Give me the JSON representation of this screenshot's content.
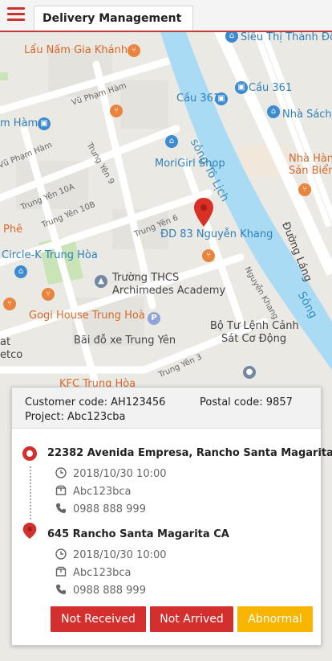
{
  "header": {
    "tab_label": "Delivery Management",
    "menu_icon": "hamburger-icon"
  },
  "map": {
    "labels": {
      "sieu_thi": "Siêu Thị Thành Đô",
      "lau_nam": "Lẩu Nấm Gia Khánh",
      "cau_361": "Cầu 361",
      "cau_361b": "Cầu 361",
      "nha_sach": "Nhà Sách",
      "vu_pham_ham": "Vũ Phạm Hàm",
      "pham_ham": "m Hàm",
      "vu_pham_ham2": "Vũ Phạm Hàm",
      "song_to_lich": "sông Tô Lịch",
      "morigirl": "MoriGirl Shop",
      "nha_hang": "Nhà Hàn",
      "san_bien": "Sản Biển",
      "trung_yen_9": "Trung Yên 9",
      "trung_yen_10a": "Trung Yên 10A",
      "trung_yen_10b": "Trung Yên 10B",
      "trung_yen_6": "Trung Yên 6",
      "duong_lang": "Đường Láng",
      "pho": "Phê",
      "dd83": "ĐD 83 Nguyễn Khang",
      "circlek": "Circle-K Trung Hòa",
      "nguyen_khang": "Nguyễn Khang",
      "truong": "Trường THCS",
      "archimedes": "Archimedes Academy",
      "song_edge": "Sông",
      "gogi": "Gogi House Trung Hoà",
      "bo_tu_lenh": "Bộ Tư Lệnh Cảnh",
      "sat_co_dong": "Sát Cơ Động",
      "at": "at",
      "etco": "etco",
      "bai_do_xe": "Bãi đỗ xe Trung Yên",
      "trung_yen_3": "Trung Yên 3",
      "kfc": "KFC Trung Hòa"
    }
  },
  "card": {
    "customer_code": "Customer code: AH123456",
    "postal_code": "Postal code: 9857",
    "project": "Project: Abc123cba",
    "pickup": {
      "address": "22382 Avenida Empresa, Rancho Santa Magarita",
      "datetime": "2018/10/30  10:00",
      "package": "Abc123bca",
      "phone": "0988 888 999"
    },
    "dropoff": {
      "address": "645 Rancho Santa Magarita CA",
      "datetime": "2018/10/30  10:00",
      "package": "Abc123bca",
      "phone": "0988 888 999"
    },
    "buttons": {
      "not_received": "Not Received",
      "not_arrived": "Not Arrived",
      "abnormal": "Abnormal"
    }
  },
  "colors": {
    "accent": "#d32f2f",
    "warning": "#f7b500",
    "river": "#a9dcf4"
  }
}
